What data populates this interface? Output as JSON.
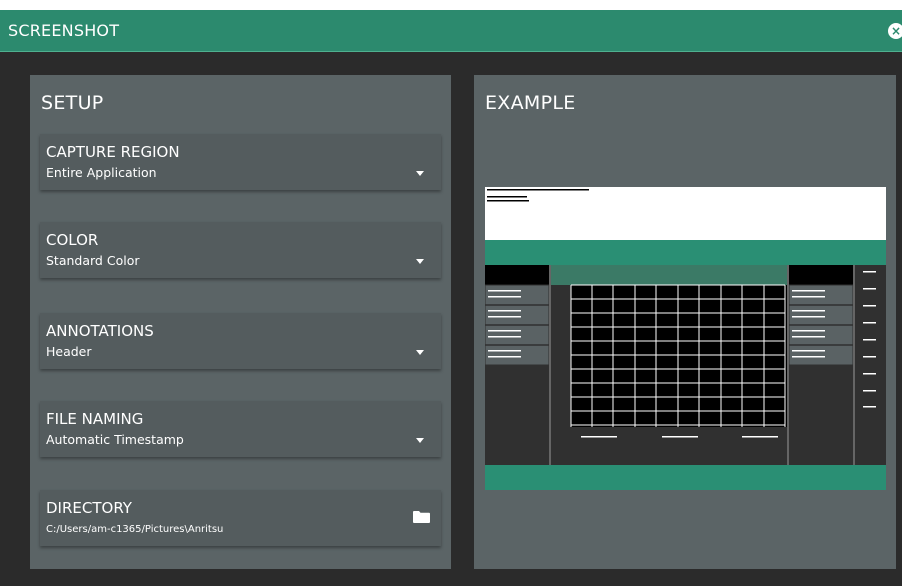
{
  "window": {
    "title": "SCREENSHOT",
    "close_icon": "×"
  },
  "setup": {
    "title": "SETUP",
    "fields": [
      {
        "label": "CAPTURE REGION",
        "value": "Entire Application"
      },
      {
        "label": "COLOR",
        "value": "Standard Color"
      },
      {
        "label": "ANNOTATIONS",
        "value": "Header"
      },
      {
        "label": "FILE NAMING",
        "value": "Automatic Timestamp"
      }
    ],
    "directory": {
      "label": "DIRECTORY",
      "value": "C:/Users/am-c1365/Pictures\\Anritsu",
      "icon": "folder-icon"
    }
  },
  "example": {
    "title": "EXAMPLE"
  },
  "colors": {
    "accent": "#2c8a6e",
    "panel": "#5b6466",
    "card": "#545c5e",
    "background": "#2b2b2b"
  }
}
